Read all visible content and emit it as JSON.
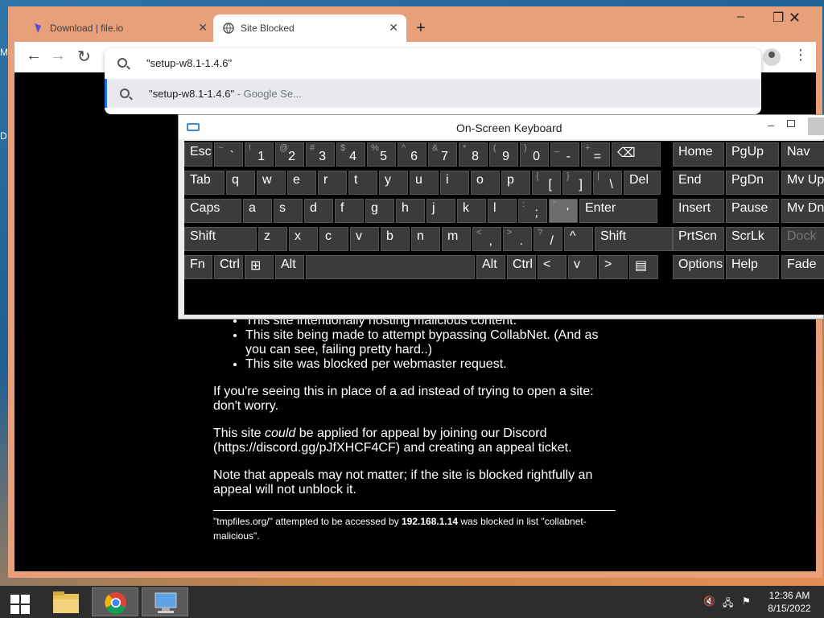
{
  "browser": {
    "tabs": [
      {
        "label": "Download | file.io",
        "close": "✕"
      },
      {
        "label": "Site Blocked",
        "close": "✕"
      }
    ],
    "new_tab": "+",
    "address": {
      "value": "\"setup-w8.1-1.4.6\"",
      "suggestion": "\"setup-w8.1-1.4.6\"",
      "suggestion_suffix": " - Google Se..."
    }
  },
  "page": {
    "bullets": [
      "This site intentionally hosting malicious content.",
      "This site being made to attempt bypassing CollabNet. (And as you can see, failing pretty hard..)",
      "This site was blocked per webmaster request."
    ],
    "para1": "If you're seeing this in place of a ad instead of trying to open a site: don't worry.",
    "para2_pre": "This site ",
    "para2_em": "could",
    "para2_post": " be applied for appeal by joining our Discord (https://discord.gg/pJfXHCF4CF) and creating an appeal ticket.",
    "para3": "Note that appeals may not matter; if the site is blocked rightfully an appeal will not unblock it.",
    "footer_pre": "\"tmpfiles.org/\" attempted to be accessed by ",
    "footer_ip": "192.168.1.14",
    "footer_post": " was blocked in list \"collabnet-malicious\"."
  },
  "osk": {
    "title": "On-Screen Keyboard",
    "rows": [
      [
        {
          "t": "Esc"
        },
        {
          "s": "~",
          "m": "`"
        },
        {
          "s": "!",
          "m": "1"
        },
        {
          "s": "@",
          "m": "2"
        },
        {
          "s": "#",
          "m": "3"
        },
        {
          "s": "$",
          "m": "4"
        },
        {
          "s": "%",
          "m": "5"
        },
        {
          "s": "^",
          "m": "6"
        },
        {
          "s": "&",
          "m": "7"
        },
        {
          "s": "*",
          "m": "8"
        },
        {
          "s": "(",
          "m": "9"
        },
        {
          "s": ")",
          "m": "0"
        },
        {
          "s": "_",
          "m": "-"
        },
        {
          "s": "+",
          "m": "="
        },
        {
          "t": "⌫"
        }
      ],
      [
        {
          "t": "Tab"
        },
        {
          "t": "q"
        },
        {
          "t": "w"
        },
        {
          "t": "e"
        },
        {
          "t": "r"
        },
        {
          "t": "t"
        },
        {
          "t": "y"
        },
        {
          "t": "u"
        },
        {
          "t": "i"
        },
        {
          "t": "o"
        },
        {
          "t": "p"
        },
        {
          "s": "{",
          "m": "["
        },
        {
          "s": "}",
          "m": "]"
        },
        {
          "s": "|",
          "m": "\\"
        },
        {
          "t": "Del"
        }
      ],
      [
        {
          "t": "Caps"
        },
        {
          "t": "a"
        },
        {
          "t": "s"
        },
        {
          "t": "d"
        },
        {
          "t": "f"
        },
        {
          "t": "g"
        },
        {
          "t": "h"
        },
        {
          "t": "j"
        },
        {
          "t": "k"
        },
        {
          "t": "l"
        },
        {
          "s": ":",
          "m": ";"
        },
        {
          "s": "\"",
          "m": "'"
        },
        {
          "t": "Enter"
        }
      ],
      [
        {
          "t": "Shift"
        },
        {
          "t": "z"
        },
        {
          "t": "x"
        },
        {
          "t": "c"
        },
        {
          "t": "v"
        },
        {
          "t": "b"
        },
        {
          "t": "n"
        },
        {
          "t": "m"
        },
        {
          "s": "<",
          "m": ","
        },
        {
          "s": ">",
          "m": "."
        },
        {
          "s": "?",
          "m": "/"
        },
        {
          "t": "^"
        },
        {
          "t": "Shift"
        }
      ],
      [
        {
          "t": "Fn"
        },
        {
          "t": "Ctrl"
        },
        {
          "t": "⊞"
        },
        {
          "t": "Alt"
        },
        {
          "t": ""
        },
        {
          "t": "Alt"
        },
        {
          "t": "Ctrl"
        },
        {
          "t": "<"
        },
        {
          "t": "v"
        },
        {
          "t": ">"
        },
        {
          "t": "▤"
        }
      ]
    ],
    "nav": [
      [
        "Home",
        "PgUp",
        "Nav"
      ],
      [
        "End",
        "PgDn",
        "Mv Up"
      ],
      [
        "Insert",
        "Pause",
        "Mv Dn"
      ],
      [
        "PrtScn",
        "ScrLk",
        "Dock"
      ],
      [
        "Options",
        "Help",
        "Fade"
      ]
    ]
  },
  "taskbar": {
    "time": "12:36 AM",
    "date": "8/15/2022"
  },
  "desktop": {
    "edge_a": "M",
    "edge_b": "D"
  }
}
